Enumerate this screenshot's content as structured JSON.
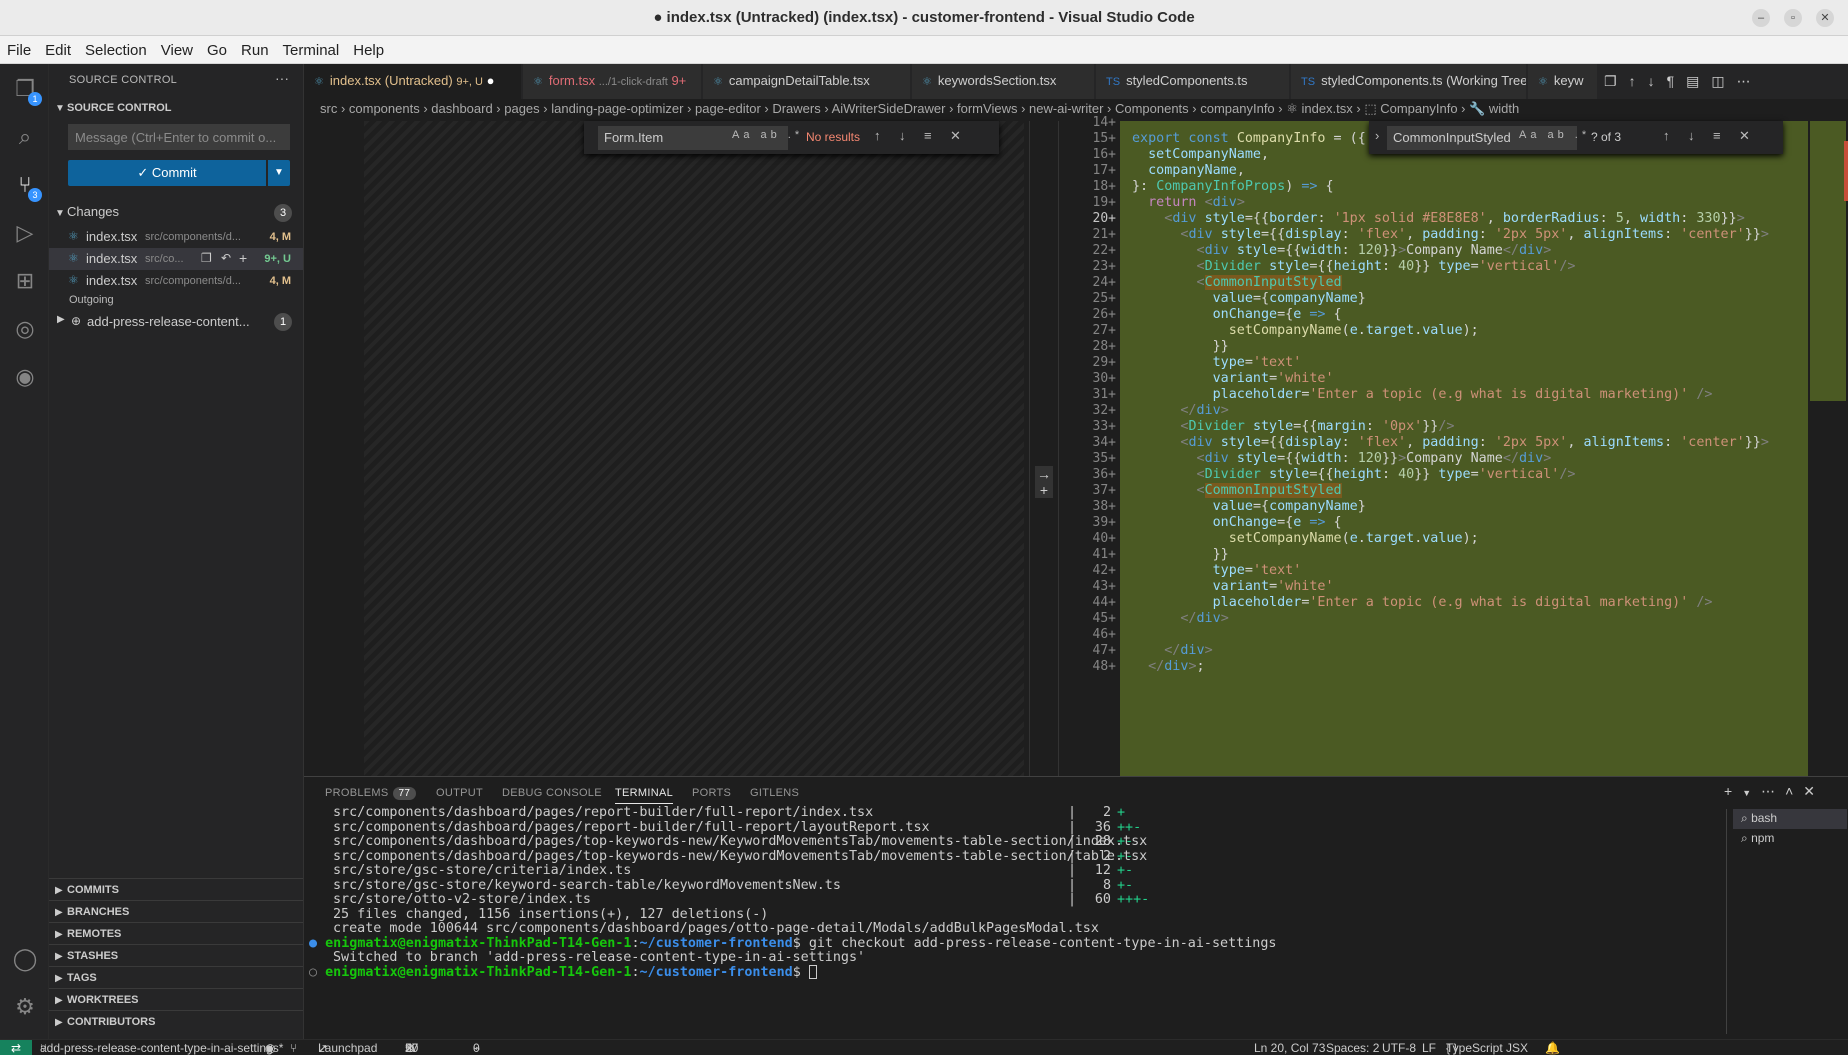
{
  "window": {
    "title": "● index.tsx (Untracked) (index.tsx) - customer-frontend - Visual Studio Code"
  },
  "menu": [
    "File",
    "Edit",
    "Selection",
    "View",
    "Go",
    "Run",
    "Terminal",
    "Help"
  ],
  "activity": {
    "explorer_badge": "1",
    "scm_badge": "3"
  },
  "sidebar": {
    "header": "SOURCE CONTROL",
    "section": "SOURCE CONTROL",
    "commit_placeholder": "Message (Ctrl+Enter to commit o...",
    "commit_label": "✓ Commit",
    "changes_label": "Changes",
    "changes_count": "3",
    "changes": [
      {
        "name": "index.tsx",
        "path": "src/components/d...",
        "status": "4, M"
      },
      {
        "name": "index.tsx",
        "path": "src/co...",
        "status": "9+, U"
      },
      {
        "name": "index.tsx",
        "path": "src/components/d...",
        "status": "4, M"
      }
    ],
    "outgoing_label": "Outgoing",
    "outgoing_item": "add-press-release-content...",
    "outgoing_count": "1",
    "bottom_sections": [
      "COMMITS",
      "BRANCHES",
      "REMOTES",
      "STASHES",
      "TAGS",
      "WORKTREES",
      "CONTRIBUTORS"
    ]
  },
  "tabs": [
    {
      "label": "index.tsx (Untracked)",
      "extra": "9+, U"
    },
    {
      "label": "form.tsx",
      "sub": ".../1-click-draft",
      "extra": "9+"
    },
    {
      "label": "campaignDetailTable.tsx"
    },
    {
      "label": "keywordsSection.tsx"
    },
    {
      "label": "styledComponents.ts"
    },
    {
      "label": "styledComponents.ts (Working Tree)"
    },
    {
      "label": "keyw"
    }
  ],
  "breadcrumb": "src  ›  components  ›  dashboard  ›  pages  ›  landing-page-optimizer  ›  page-editor  ›  Drawers  ›  AiWriterSideDrawer  ›  formViews  ›  new-ai-writer  ›  Components  ›  companyInfo  ›  ⚛ index.tsx  ›  ⬚ CompanyInfo  ›  🔧 width",
  "find_left": {
    "value": "Form.Item",
    "opts": "Aa ab .*",
    "result": "No results"
  },
  "find_right": {
    "value": "CommonInputStyled",
    "opts": "Aa ab .*",
    "result": "? of 3"
  },
  "line_numbers": [
    "14+",
    "15+",
    "16+",
    "17+",
    "18+",
    "19+",
    "20+",
    "21+",
    "22+",
    "23+",
    "24+",
    "25+",
    "26+",
    "27+",
    "28+",
    "29+",
    "30+",
    "31+",
    "32+",
    "33+",
    "34+",
    "35+",
    "36+",
    "37+",
    "38+",
    "39+",
    "40+",
    "41+",
    "42+",
    "43+",
    "44+",
    "45+",
    "46+",
    "47+",
    "48+"
  ],
  "panel": {
    "tabs": [
      "PROBLEMS",
      "OUTPUT",
      "DEBUG CONSOLE",
      "TERMINAL",
      "PORTS",
      "GITLENS"
    ],
    "problems_count": "77",
    "terminals": [
      "bash",
      "npm"
    ],
    "stat_lines": [
      {
        "file": "src/components/dashboard/pages/report-builder/full-report/index.tsx",
        "n": "2",
        "bar": "+"
      },
      {
        "file": "src/components/dashboard/pages/report-builder/full-report/layoutReport.tsx",
        "n": "36",
        "bar": "++-"
      },
      {
        "file": "src/components/dashboard/pages/top-keywords-new/KeywordMovementsTab/movements-table-section/index.tsx",
        "n": "28",
        "bar": "+-"
      },
      {
        "file": "src/components/dashboard/pages/top-keywords-new/KeywordMovementsTab/movements-table-section/table.tsx",
        "n": "2",
        "bar": "+-"
      },
      {
        "file": "src/store/gsc-store/criteria/index.ts",
        "n": "12",
        "bar": "+-"
      },
      {
        "file": "src/store/gsc-store/keyword-search-table/keywordMovementsNew.ts",
        "n": "8",
        "bar": "+-"
      },
      {
        "file": "src/store/otto-v2-store/index.ts",
        "n": "60",
        "bar": "+++-"
      }
    ],
    "summary": "25 files changed, 1156 insertions(+), 127 deletions(-)",
    "create_mode": "create mode 100644 src/components/dashboard/pages/otto-page-detail/Modals/addBulkPagesModal.tsx",
    "prompt_user": "enigmatix@enigmatix-ThinkPad-T14-Gen-1",
    "prompt_path": "~/customer-frontend",
    "command": "git checkout add-press-release-content-type-in-ai-settings",
    "switched": "Switched to branch 'add-press-release-content-type-in-ai-settings'"
  },
  "status": {
    "branch": "add-press-release-content-type-in-ai-settings*",
    "launchpad": "Launchpad",
    "errors": "27",
    "warnings": "50",
    "ports": "0",
    "position": "Ln 20, Col 73",
    "spaces": "Spaces: 2",
    "encoding": "UTF-8",
    "eol": "LF",
    "language": "TypeScript JSX"
  }
}
